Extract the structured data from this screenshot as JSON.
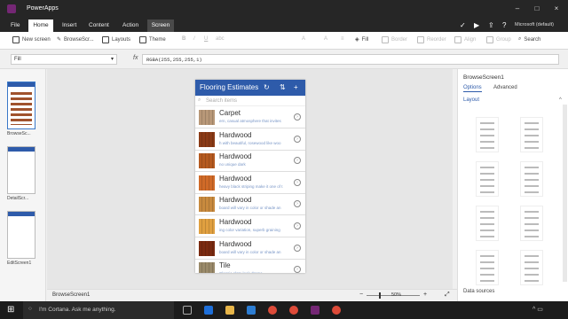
{
  "window": {
    "app_title": "PowerApps",
    "account": "Microsoft (default)"
  },
  "menu": {
    "tabs": [
      "File",
      "Home",
      "Insert",
      "Content",
      "Action",
      "Screen"
    ]
  },
  "ribbon": {
    "new_screen": "New screen",
    "browse": "BrowseScr...",
    "layouts": "Layouts",
    "theme": "Theme",
    "fill": "Fill",
    "border": "Border",
    "reorder": "Reorder",
    "align": "Align",
    "group": "Group",
    "search": "Search"
  },
  "formula": {
    "property": "Fill",
    "fx": "fx",
    "value": "RGBA(255,255,255,1)"
  },
  "left_pane": {
    "screens": [
      "BrowseSc...",
      "DetailScr...",
      "EditScreen1"
    ]
  },
  "phone": {
    "title": "Flooring Estimates",
    "search_placeholder": "Search items",
    "items": [
      {
        "title": "Carpet",
        "desc": "ern, casual atmosphere that invites",
        "color": "#b89878"
      },
      {
        "title": "Hardwood",
        "desc": "h with beautiful, rosewood like woo",
        "color": "#8a3a16"
      },
      {
        "title": "Hardwood",
        "desc": "no unique dark",
        "color": "#b55a20"
      },
      {
        "title": "Hardwood",
        "desc": "heavy black striping make it one of t",
        "color": "#d06a28"
      },
      {
        "title": "Hardwood",
        "desc": "board will vary in color or shade an",
        "color": "#c88a3e"
      },
      {
        "title": "Hardwood",
        "desc": "ing color variation, superb graining",
        "color": "#e0a040"
      },
      {
        "title": "Hardwood",
        "desc": "board will vary in color or shade an",
        "color": "#7a2a10"
      },
      {
        "title": "Tile",
        "desc": "Classic slate look drama",
        "color": "#9a8a6a"
      }
    ]
  },
  "right_pane": {
    "title": "BrowseScreen1",
    "tab_options": "Options",
    "tab_advanced": "Advanced",
    "layout_label": "Layout",
    "data_sources": "Data sources"
  },
  "status": {
    "screen": "BrowseScreen1",
    "zoom": "50%"
  },
  "taskbar": {
    "cortana": "I'm Cortana. Ask me anything."
  }
}
